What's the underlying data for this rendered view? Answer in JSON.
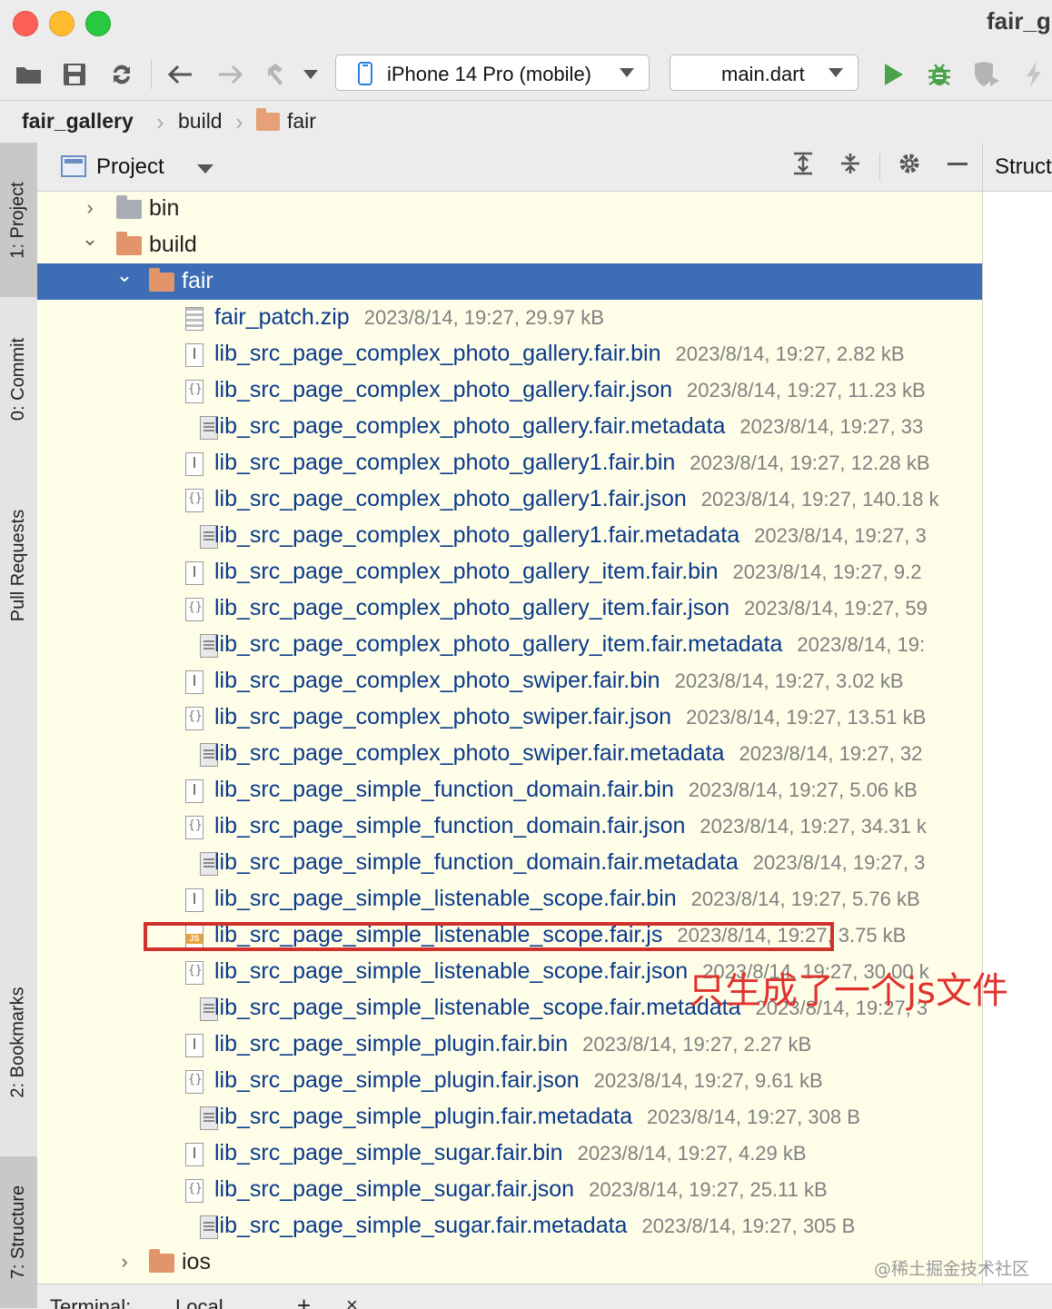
{
  "window": {
    "title": "fair_g"
  },
  "toolbar": {
    "device_selector": "iPhone 14 Pro (mobile)",
    "run_config": "main.dart",
    "icons": [
      "open-folder-icon",
      "save-icon",
      "sync-icon",
      "back-arrow-icon",
      "forward-arrow-icon",
      "hammer-build-icon",
      "run-icon",
      "debug-icon",
      "profile-icon",
      "hot-reload-icon"
    ]
  },
  "breadcrumb": {
    "items": [
      "fair_gallery",
      "build",
      "fair"
    ]
  },
  "left_strip": {
    "tabs": [
      "1: Project",
      "0: Commit",
      "Pull Requests",
      "2: Bookmarks",
      "7: Structure"
    ]
  },
  "project_panel": {
    "title": "Project",
    "tree": [
      {
        "name": "bin",
        "type": "folder",
        "color": "grey",
        "state": "collapsed",
        "level": 1
      },
      {
        "name": "build",
        "type": "folder",
        "color": "orange",
        "state": "expanded",
        "level": 1
      },
      {
        "name": "fair",
        "type": "folder",
        "color": "orange",
        "state": "expanded",
        "level": 2,
        "selected": true
      },
      {
        "name": "fair_patch.zip",
        "meta": "2023/8/14, 19:27, 29.97 kB",
        "type": "zip",
        "level": 3
      },
      {
        "name": "lib_src_page_complex_photo_gallery.fair.bin",
        "meta": "2023/8/14, 19:27, 2.82 kB",
        "type": "bin",
        "level": 3
      },
      {
        "name": "lib_src_page_complex_photo_gallery.fair.json",
        "meta": "2023/8/14, 19:27, 11.23 kB",
        "type": "json",
        "level": 3
      },
      {
        "name": "lib_src_page_complex_photo_gallery.fair.metadata",
        "meta": "2023/8/14, 19:27, 33",
        "type": "meta",
        "level": 3
      },
      {
        "name": "lib_src_page_complex_photo_gallery1.fair.bin",
        "meta": "2023/8/14, 19:27, 12.28 kB",
        "type": "bin",
        "level": 3
      },
      {
        "name": "lib_src_page_complex_photo_gallery1.fair.json",
        "meta": "2023/8/14, 19:27, 140.18 k",
        "type": "json",
        "level": 3
      },
      {
        "name": "lib_src_page_complex_photo_gallery1.fair.metadata",
        "meta": "2023/8/14, 19:27, 3",
        "type": "meta",
        "level": 3
      },
      {
        "name": "lib_src_page_complex_photo_gallery_item.fair.bin",
        "meta": "2023/8/14, 19:27, 9.2",
        "type": "bin",
        "level": 3
      },
      {
        "name": "lib_src_page_complex_photo_gallery_item.fair.json",
        "meta": "2023/8/14, 19:27, 59",
        "type": "json",
        "level": 3
      },
      {
        "name": "lib_src_page_complex_photo_gallery_item.fair.metadata",
        "meta": "2023/8/14, 19:",
        "type": "meta",
        "level": 3
      },
      {
        "name": "lib_src_page_complex_photo_swiper.fair.bin",
        "meta": "2023/8/14, 19:27, 3.02 kB",
        "type": "bin",
        "level": 3
      },
      {
        "name": "lib_src_page_complex_photo_swiper.fair.json",
        "meta": "2023/8/14, 19:27, 13.51 kB",
        "type": "json",
        "level": 3
      },
      {
        "name": "lib_src_page_complex_photo_swiper.fair.metadata",
        "meta": "2023/8/14, 19:27, 32",
        "type": "meta",
        "level": 3
      },
      {
        "name": "lib_src_page_simple_function_domain.fair.bin",
        "meta": "2023/8/14, 19:27, 5.06 kB",
        "type": "bin",
        "level": 3
      },
      {
        "name": "lib_src_page_simple_function_domain.fair.json",
        "meta": "2023/8/14, 19:27, 34.31 k",
        "type": "json",
        "level": 3
      },
      {
        "name": "lib_src_page_simple_function_domain.fair.metadata",
        "meta": "2023/8/14, 19:27, 3",
        "type": "meta",
        "level": 3
      },
      {
        "name": "lib_src_page_simple_listenable_scope.fair.bin",
        "meta": "2023/8/14, 19:27, 5.76 kB",
        "type": "bin",
        "level": 3
      },
      {
        "name": "lib_src_page_simple_listenable_scope.fair.js",
        "meta": "2023/8/14, 19:27, 3.75 kB",
        "type": "js",
        "level": 3,
        "highlighted": true
      },
      {
        "name": "lib_src_page_simple_listenable_scope.fair.json",
        "meta": "2023/8/14, 19:27, 30.00 k",
        "type": "json",
        "level": 3
      },
      {
        "name": "lib_src_page_simple_listenable_scope.fair.metadata",
        "meta": "2023/8/14, 19:27, 3",
        "type": "meta",
        "level": 3
      },
      {
        "name": "lib_src_page_simple_plugin.fair.bin",
        "meta": "2023/8/14, 19:27, 2.27 kB",
        "type": "bin",
        "level": 3
      },
      {
        "name": "lib_src_page_simple_plugin.fair.json",
        "meta": "2023/8/14, 19:27, 9.61 kB",
        "type": "json",
        "level": 3
      },
      {
        "name": "lib_src_page_simple_plugin.fair.metadata",
        "meta": "2023/8/14, 19:27, 308 B",
        "type": "meta",
        "level": 3
      },
      {
        "name": "lib_src_page_simple_sugar.fair.bin",
        "meta": "2023/8/14, 19:27, 4.29 kB",
        "type": "bin",
        "level": 3
      },
      {
        "name": "lib_src_page_simple_sugar.fair.json",
        "meta": "2023/8/14, 19:27, 25.11 kB",
        "type": "json",
        "level": 3
      },
      {
        "name": "lib_src_page_simple_sugar.fair.metadata",
        "meta": "2023/8/14, 19:27, 305 B",
        "type": "meta",
        "level": 3
      },
      {
        "name": "ios",
        "type": "folder",
        "color": "orange",
        "state": "collapsed",
        "level": 2
      }
    ]
  },
  "right_panel": {
    "title": "Struct"
  },
  "bottom_bar": {
    "tab_terminal": "Terminal:",
    "tab_local": "Local"
  },
  "annotation": {
    "text": "只生成了一个js文件",
    "color": "#e0322c"
  },
  "watermark": "@稀土掘金技术社区",
  "colors": {
    "selection": "#3d6eb5",
    "tree_background": "#fefde8",
    "highlight": "#d0312d"
  }
}
